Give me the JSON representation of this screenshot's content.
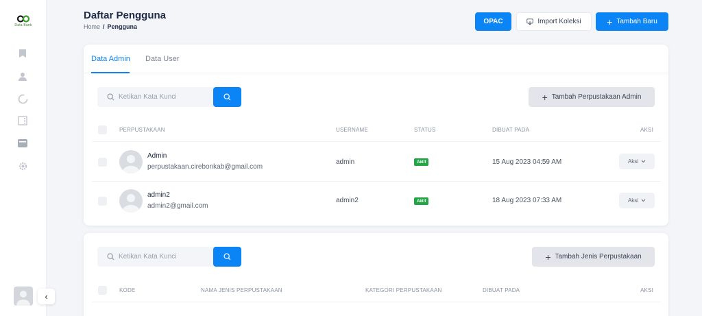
{
  "sidebar": {
    "logo_text": "Data Bank",
    "icons": [
      "bookmark-icon",
      "user-icon",
      "loading-icon",
      "list-icon",
      "archive-icon",
      "gear-icon"
    ],
    "collapse_glyph": "‹"
  },
  "header": {
    "title": "Daftar Pengguna",
    "breadcrumb": {
      "home": "Home",
      "separator": "/",
      "current": "Pengguna"
    },
    "opac_label": "OPAC",
    "import_label": "Import Koleksi",
    "add_new_label": "Tambah Baru"
  },
  "admin_card": {
    "tabs": [
      {
        "label": "Data Admin"
      },
      {
        "label": "Data User"
      }
    ],
    "search": {
      "placeholder": "Ketikan Kata Kunci",
      "value": ""
    },
    "add_button_label": "Tambah Perpustakaan Admin",
    "columns": [
      "PERPUSTAKAAN",
      "USERNAME",
      "STATUS",
      "DIBUAT PADA",
      "AKSI"
    ],
    "rows": [
      {
        "name": "Admin",
        "email": "perpustakaan.cirebonkab@gmail.com",
        "username": "admin",
        "status": "Aktif",
        "created": "15 Aug 2023 04:59 AM",
        "action": "Aksi"
      },
      {
        "name": "admin2",
        "email": "admin2@gmail.com",
        "username": "admin2",
        "status": "Aktif",
        "created": "18 Aug 2023 07:33 AM",
        "action": "Aksi"
      }
    ]
  },
  "type_card": {
    "search": {
      "placeholder": "Ketikan Kata Kunci",
      "value": ""
    },
    "add_button_label": "Tambah Jenis Perpustakaan",
    "columns": [
      "KODE",
      "NAMA JENIS PERPUSTAKAAN",
      "KATEGORI PERPUSTAKAAN",
      "DIBUAT PADA",
      "AKSI"
    ]
  },
  "colors": {
    "primary": "#0b84f5",
    "status_active": "#23a547",
    "background": "#f3f5f8"
  }
}
